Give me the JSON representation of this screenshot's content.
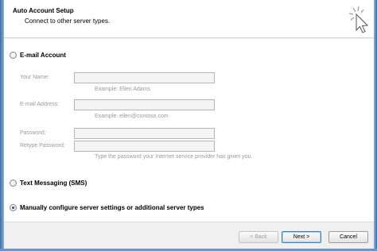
{
  "header": {
    "title": "Auto Account Setup",
    "subtitle": "Connect to other server types."
  },
  "options": {
    "email": {
      "label": "E-mail Account",
      "selected": false,
      "fields": {
        "your_name_label": "Your Name:",
        "your_name_value": "",
        "your_name_hint": "Example: Ellen Adams",
        "email_label": "E-mail Address:",
        "email_value": "",
        "email_hint": "Example: ellen@contoso.com",
        "password_label": "Password:",
        "password_value": "",
        "retype_label": "Retype Password:",
        "retype_value": "",
        "password_hint": "Type the password your Internet service provider has given you."
      }
    },
    "sms": {
      "label": "Text Messaging (SMS)",
      "selected": false
    },
    "manual": {
      "label": "Manually configure server settings or additional server types",
      "selected": true
    }
  },
  "footer": {
    "back_label": "< Back",
    "next_label": "Next >",
    "cancel_label": "Cancel"
  },
  "icons": {
    "header_icon": "cursor-click-icon"
  }
}
